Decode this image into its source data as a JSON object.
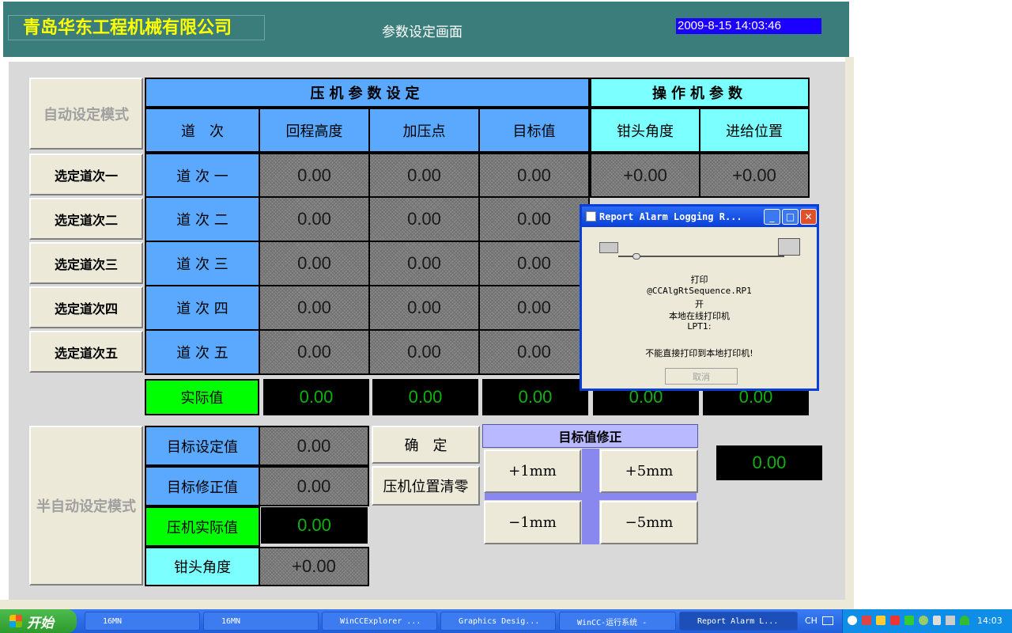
{
  "header": {
    "company": "青岛华东工程机械有限公司",
    "screen_title": "参数设定画面",
    "datetime": "2009-8-15 14:03:46"
  },
  "side": {
    "auto_mode": "自动设定模式",
    "passes": [
      "选定道次一",
      "选定道次二",
      "选定道次三",
      "选定道次四",
      "选定道次五"
    ],
    "semi_mode": "半自动设定模式"
  },
  "table": {
    "press_header": "压机参数设定",
    "manip_header": "操作机参数",
    "columns": [
      "道　次",
      "回程高度",
      "加压点",
      "目标值",
      "钳头角度",
      "进给位置"
    ],
    "rows": [
      {
        "label": "道 次 一",
        "values": [
          "0.00",
          "0.00",
          "0.00",
          "+0.00",
          "+0.00"
        ]
      },
      {
        "label": "道 次 二",
        "values": [
          "0.00",
          "0.00",
          "0.00"
        ]
      },
      {
        "label": "道 次 三",
        "values": [
          "0.00",
          "0.00",
          "0.00"
        ]
      },
      {
        "label": "道 次 四",
        "values": [
          "0.00",
          "0.00",
          "0.00"
        ]
      },
      {
        "label": "道 次 五",
        "values": [
          "0.00",
          "0.00",
          "0.00"
        ]
      }
    ],
    "actual_label": "实际值",
    "actual_values": [
      "0.00",
      "0.00",
      "0.00",
      "0.00",
      "0.00"
    ]
  },
  "semi": {
    "target_set_label": "目标设定值",
    "target_set_value": "0.00",
    "target_corr_label": "目标修正值",
    "target_corr_value": "0.00",
    "press_actual_label": "压机实际值",
    "press_actual_value": "0.00",
    "tong_angle_label": "钳头角度",
    "tong_angle_value": "+0.00",
    "confirm_button": "确　定",
    "reset_button": "压机位置清零",
    "correction_title": "目标值修正",
    "plus1": "+1mm",
    "plus5": "+5mm",
    "minus1": "−1mm",
    "minus5": "−5mm",
    "display_value": "0.00"
  },
  "dialog": {
    "title": "Report Alarm Logging R...",
    "lines": [
      "打印",
      "@CCAlgRtSequence.RP1",
      "开",
      "本地在线打印机",
      "LPT1:"
    ],
    "error": "不能直接打印到本地打印机!",
    "cancel": "取消"
  },
  "taskbar": {
    "start": "开始",
    "tasks": [
      "16MN",
      "16MN",
      "WinCCExplorer ...",
      "Graphics Desig...",
      "WinCC-运行系统 -",
      "Report Alarm L..."
    ],
    "lang": "CH",
    "clock": "14:03"
  }
}
